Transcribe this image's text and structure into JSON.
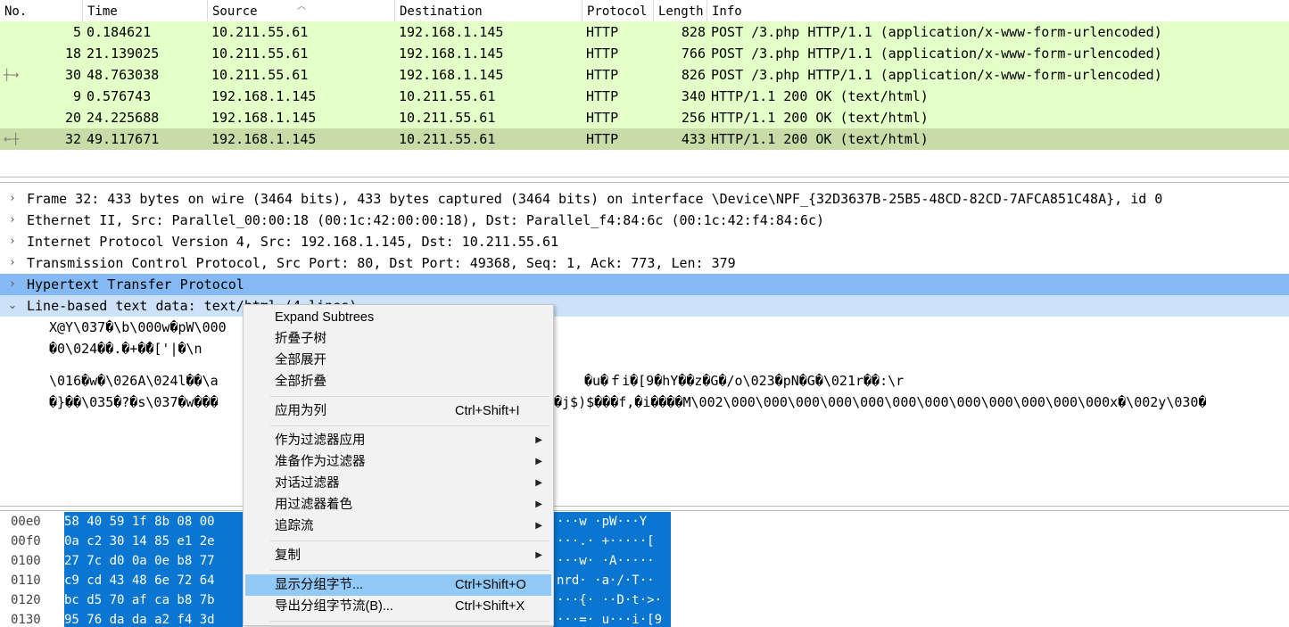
{
  "packet_list": {
    "columns": [
      "No.",
      "Time",
      "Source",
      "Destination",
      "Protocol",
      "Length",
      "Info"
    ],
    "rows": [
      {
        "no": "5",
        "time": "0.184621",
        "src": "10.211.55.61",
        "dst": "192.168.1.145",
        "proto": "HTTP",
        "len": "828",
        "info": "POST /3.php HTTP/1.1  (application/x-www-form-urlencoded)",
        "selected": false,
        "marker": ""
      },
      {
        "no": "18",
        "time": "21.139025",
        "src": "10.211.55.61",
        "dst": "192.168.1.145",
        "proto": "HTTP",
        "len": "766",
        "info": "POST /3.php HTTP/1.1  (application/x-www-form-urlencoded)",
        "selected": false,
        "marker": ""
      },
      {
        "no": "30",
        "time": "48.763038",
        "src": "10.211.55.61",
        "dst": "192.168.1.145",
        "proto": "HTTP",
        "len": "826",
        "info": "POST /3.php HTTP/1.1  (application/x-www-form-urlencoded)",
        "selected": false,
        "marker": "request"
      },
      {
        "no": "9",
        "time": "0.576743",
        "src": "192.168.1.145",
        "dst": "10.211.55.61",
        "proto": "HTTP",
        "len": "340",
        "info": "HTTP/1.1 200 OK  (text/html)",
        "selected": false,
        "marker": ""
      },
      {
        "no": "20",
        "time": "24.225688",
        "src": "192.168.1.145",
        "dst": "10.211.55.61",
        "proto": "HTTP",
        "len": "256",
        "info": "HTTP/1.1 200 OK  (text/html)",
        "selected": false,
        "marker": ""
      },
      {
        "no": "32",
        "time": "49.117671",
        "src": "192.168.1.145",
        "dst": "10.211.55.61",
        "proto": "HTTP",
        "len": "433",
        "info": "HTTP/1.1 200 OK  (text/html)",
        "selected": true,
        "marker": "response"
      }
    ]
  },
  "details": {
    "rows": [
      {
        "arrow": "›",
        "text": "Frame 32: 433 bytes on wire (3464 bits), 433 bytes captured (3464 bits) on interface \\Device\\NPF_{32D3637B-25B5-48CD-82CD-7AFCA851C48A}, id 0",
        "style": "",
        "child": false
      },
      {
        "arrow": "›",
        "text": "Ethernet II, Src: Parallel_00:00:18 (00:1c:42:00:00:18), Dst: Parallel_f4:84:6c (00:1c:42:f4:84:6c)",
        "style": "",
        "child": false
      },
      {
        "arrow": "›",
        "text": "Internet Protocol Version 4, Src: 192.168.1.145, Dst: 10.211.55.61",
        "style": "",
        "child": false
      },
      {
        "arrow": "›",
        "text": "Transmission Control Protocol, Src Port: 80, Dst Port: 49368, Seq: 1, Ack: 773, Len: 379",
        "style": "",
        "child": false
      },
      {
        "arrow": "›",
        "text": "Hypertext Transfer Protocol",
        "style": "hl",
        "child": false
      },
      {
        "arrow": "⌄",
        "text": "Line-based text data: text/html (4 lines)",
        "style": "sub",
        "child": false
      },
      {
        "arrow": "",
        "text": "X@Y\\037�\\b\\000w�pW\\000",
        "style": "",
        "child": true
      },
      {
        "arrow": "",
        "text": "�0\\024��.�+�̄�['|�\\n",
        "style": "",
        "child": true
      },
      {
        "arrow": "",
        "text": "\\016�w�\\026A\\024l��\\a",
        "tail": "�u�ｆi�[9�hY��z�G�/o\\023�pN�G�\\021r��:\\r",
        "style": "",
        "child": true
      },
      {
        "arrow": "",
        "text": "�}��\\035�?�s\\037�w���",
        "tail": "�j$)$���f,�i����M\\002\\000\\000\\000\\000\\000\\000\\000\\000\\000\\000\\000\\000x�\\002y\\030�",
        "style": "",
        "child": true
      }
    ]
  },
  "bytes": {
    "rows": [
      {
        "offset": "00e0",
        "hex": "58 40 59 1f 8b 08 00",
        "ascii": "···w ·pW···Y"
      },
      {
        "offset": "00f0",
        "hex": "0a c2 30 14 85 e1 2e",
        "ascii": "···.· +·····["
      },
      {
        "offset": "0100",
        "hex": "27 7c d0 0a 0e b8 77",
        "ascii": "···w· ·A·····"
      },
      {
        "offset": "0110",
        "hex": "c9 cd 43 48 6e 72 64",
        "ascii": "nrd· ·a·/·T··"
      },
      {
        "offset": "0120",
        "hex": "bc d5 70 af ca b8 7b",
        "ascii": "···{· ··D·t·>·"
      },
      {
        "offset": "0130",
        "hex": "95 76 da da a2 f4 3d",
        "ascii": "···=· u···i·[9"
      }
    ]
  },
  "context_menu": {
    "items": [
      {
        "label": "Expand Subtrees",
        "shortcut": "",
        "submenu": false,
        "hover": false
      },
      {
        "label": "折叠子树",
        "shortcut": "",
        "submenu": false,
        "hover": false
      },
      {
        "label": "全部展开",
        "shortcut": "",
        "submenu": false,
        "hover": false
      },
      {
        "label": "全部折叠",
        "shortcut": "",
        "submenu": false,
        "hover": false
      },
      {
        "sep": true
      },
      {
        "label": "应用为列",
        "shortcut": "Ctrl+Shift+I",
        "submenu": false,
        "hover": false
      },
      {
        "sep": true
      },
      {
        "label": "作为过滤器应用",
        "shortcut": "",
        "submenu": true,
        "hover": false
      },
      {
        "label": "准备作为过滤器",
        "shortcut": "",
        "submenu": true,
        "hover": false
      },
      {
        "label": "对话过滤器",
        "shortcut": "",
        "submenu": true,
        "hover": false
      },
      {
        "label": "用过滤器着色",
        "shortcut": "",
        "submenu": true,
        "hover": false
      },
      {
        "label": "追踪流",
        "shortcut": "",
        "submenu": true,
        "hover": false
      },
      {
        "sep": true
      },
      {
        "label": "复制",
        "shortcut": "",
        "submenu": true,
        "hover": false
      },
      {
        "sep": true
      },
      {
        "label": "显示分组字节...",
        "shortcut": "Ctrl+Shift+O",
        "submenu": false,
        "hover": true
      },
      {
        "label": "导出分组字节流(B)...",
        "shortcut": "Ctrl+Shift+X",
        "submenu": false,
        "hover": false
      },
      {
        "sep": true
      }
    ]
  },
  "colors": {
    "row_bg": "#e4ffc7",
    "row_selected": "#c7dca6",
    "detail_highlight": "#85b9f3",
    "bytes_highlight": "#0a76d2",
    "menu_hover": "#91c9f7"
  }
}
